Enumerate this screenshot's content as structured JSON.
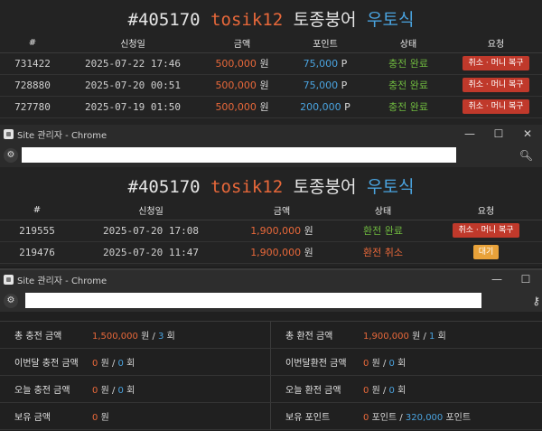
{
  "charge_panel": {
    "title": {
      "id": "#405170",
      "user": "tosik12",
      "name": "토종붕어",
      "grade": "우토식"
    },
    "columns": [
      "#",
      "신청일",
      "금액",
      "포인트",
      "상태",
      "요청"
    ],
    "rows": [
      {
        "no": "731422",
        "date": "2025-07-22 17:46",
        "amount": "500,000",
        "amount_unit": "원",
        "points": "75,000",
        "points_unit": "P",
        "status": "충전 완료",
        "action": "취소 · 머니 복구"
      },
      {
        "no": "728880",
        "date": "2025-07-20 00:51",
        "amount": "500,000",
        "amount_unit": "원",
        "points": "75,000",
        "points_unit": "P",
        "status": "충전 완료",
        "action": "취소 · 머니 복구"
      },
      {
        "no": "727780",
        "date": "2025-07-19 01:50",
        "amount": "500,000",
        "amount_unit": "원",
        "points": "200,000",
        "points_unit": "P",
        "status": "충전 완료",
        "action": "취소 · 머니 복구"
      }
    ]
  },
  "window1": {
    "title": "Site 관리자 - Chrome",
    "minimize": "—",
    "maximize": "☐",
    "close": "✕"
  },
  "exchange_panel": {
    "title": {
      "id": "#405170",
      "user": "tosik12",
      "name": "토종붕어",
      "grade": "우토식"
    },
    "columns": [
      "#",
      "신청일",
      "금액",
      "상태",
      "요청"
    ],
    "rows": [
      {
        "no": "219555",
        "date": "2025-07-20 17:08",
        "amount": "1,900,000",
        "amount_unit": "원",
        "status": "환전 완료",
        "status_type": "ok",
        "action": "취소 · 머니 복구",
        "action_type": "btn"
      },
      {
        "no": "219476",
        "date": "2025-07-20 11:47",
        "amount": "1,900,000",
        "amount_unit": "원",
        "status": "환전 취소",
        "status_type": "cancel",
        "action": "대기",
        "action_type": "wait"
      }
    ]
  },
  "window2": {
    "title": "Site 관리자 - Chrome",
    "minimize": "—",
    "maximize": "☐"
  },
  "summary": {
    "total_charge": {
      "label": "총 충전 금액",
      "amount": "1,500,000",
      "unit": "원",
      "sep": "/",
      "count": "3",
      "count_unit": "회"
    },
    "total_exchange": {
      "label": "총 환전 금액",
      "amount": "1,900,000",
      "unit": "원",
      "sep": "/",
      "count": "1",
      "count_unit": "회"
    },
    "month_charge": {
      "label": "이번달 충전 금액",
      "amount": "0",
      "unit": "원",
      "sep": "/",
      "count": "0",
      "count_unit": "회"
    },
    "month_exchange": {
      "label": "이번달환전 금액",
      "amount": "0",
      "unit": "원",
      "sep": "/",
      "count": "0",
      "count_unit": "회"
    },
    "today_charge": {
      "label": "오늘 충전 금액",
      "amount": "0",
      "unit": "원",
      "sep": "/",
      "count": "0",
      "count_unit": "회"
    },
    "today_exchange": {
      "label": "오늘 환전 금액",
      "amount": "0",
      "unit": "원",
      "sep": "/",
      "count": "0",
      "count_unit": "회"
    },
    "balance": {
      "label": "보유 금액",
      "amount": "0",
      "unit": "원"
    },
    "points": {
      "label": "보유 포인트",
      "amount": "0",
      "unit": "포인트",
      "sep": "/",
      "total": "320,000",
      "total_unit": "포인트"
    }
  },
  "colors": {
    "accent_orange": "#e8683a",
    "accent_blue": "#4aa3df",
    "ok_green": "#6fb83f",
    "button_red": "#c0392b",
    "wait_orange": "#e8a23a"
  }
}
